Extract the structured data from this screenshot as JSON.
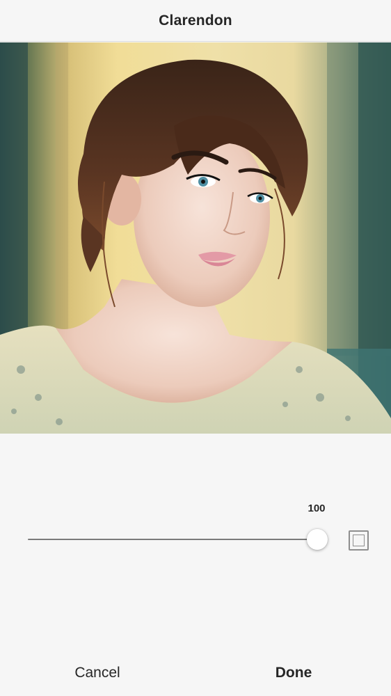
{
  "header": {
    "title": "Clarendon"
  },
  "photo": {
    "subject": "portrait-photo"
  },
  "adjustment": {
    "value": "100",
    "level": 1.0,
    "frame_icon": "frame-icon"
  },
  "footer": {
    "cancel_label": "Cancel",
    "done_label": "Done"
  },
  "colors": {
    "background": "#f6f6f6",
    "text": "#262626",
    "track": "#7a7a7a",
    "icon": "#8e8e8e"
  }
}
